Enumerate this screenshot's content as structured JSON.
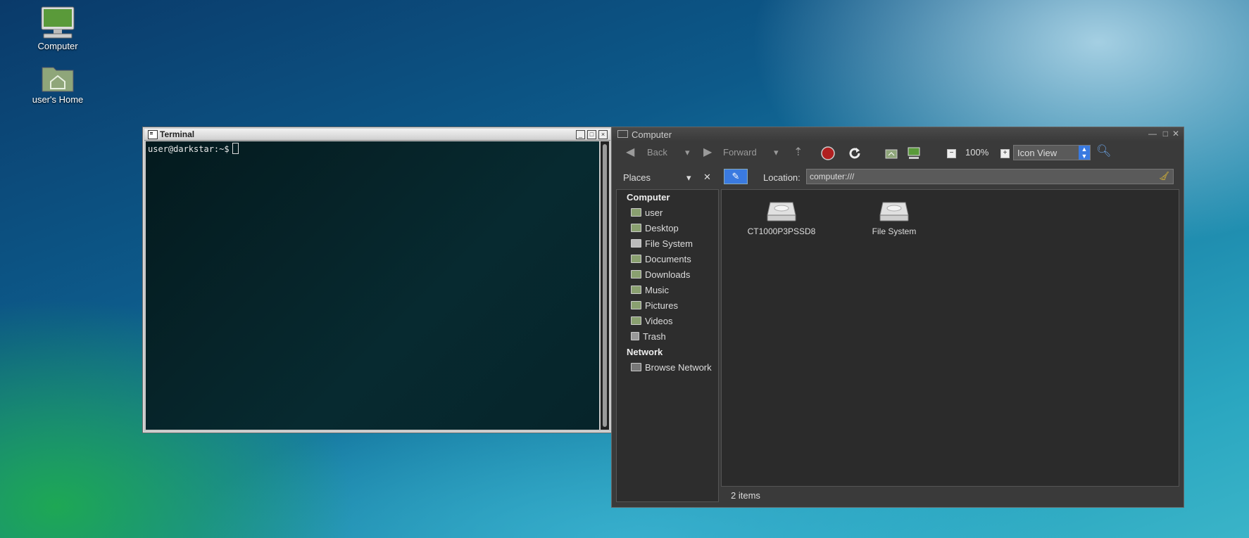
{
  "desktop": {
    "icons": [
      {
        "label": "Computer"
      },
      {
        "label": "user's Home"
      }
    ]
  },
  "terminal": {
    "title": "Terminal",
    "prompt": "user@darkstar:~$"
  },
  "file_manager": {
    "title": "Computer",
    "toolbar": {
      "back_label": "Back",
      "forward_label": "Forward",
      "zoom": "100%",
      "view_mode": "Icon View"
    },
    "navbar": {
      "places_label": "Places",
      "location_label": "Location:",
      "location_value": "computer:///"
    },
    "sidebar": {
      "computer_header": "Computer",
      "items": [
        {
          "label": "user"
        },
        {
          "label": "Desktop"
        },
        {
          "label": "File System"
        },
        {
          "label": "Documents"
        },
        {
          "label": "Downloads"
        },
        {
          "label": "Music"
        },
        {
          "label": "Pictures"
        },
        {
          "label": "Videos"
        },
        {
          "label": "Trash"
        }
      ],
      "network_header": "Network",
      "network_items": [
        {
          "label": "Browse Network"
        }
      ]
    },
    "content": {
      "items": [
        {
          "label": "CT1000P3PSSD8"
        },
        {
          "label": "File System"
        }
      ]
    },
    "status": "2 items"
  }
}
